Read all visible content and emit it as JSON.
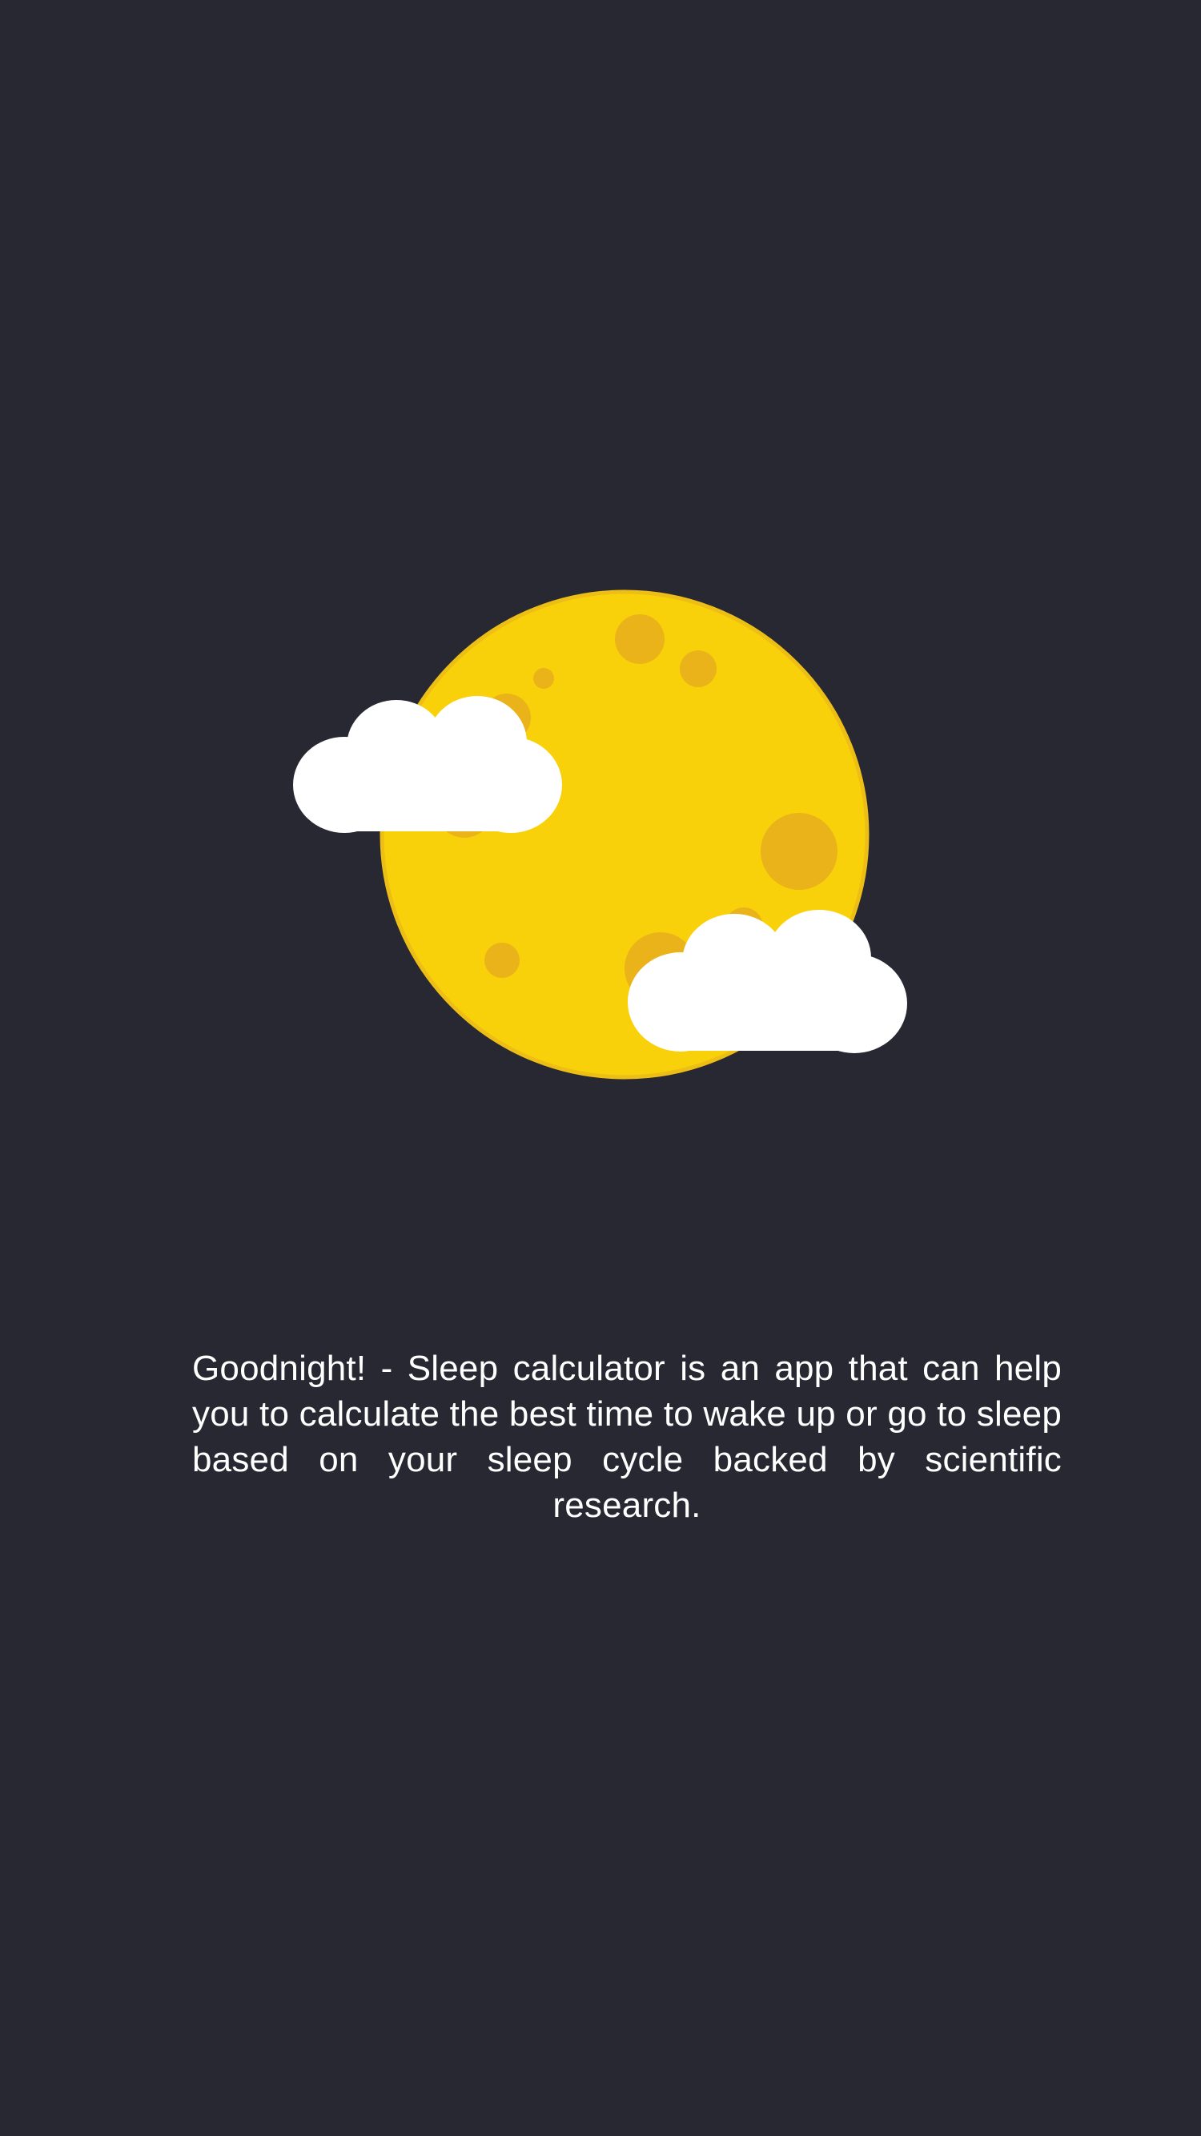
{
  "theme": {
    "background": "#272832",
    "moon": "#F9D10A",
    "moon_outline": "#EDBE15",
    "crater": "#EAB319",
    "cloud": "#FFFFFF",
    "text": "#FFFFFF"
  },
  "illustration": {
    "name": "moon-with-clouds"
  },
  "intro": {
    "description": "Goodnight! - Sleep calculator is an app that can help you to calculate the best time to wake up or go to sleep based on your sleep cycle backed by scientific research."
  }
}
